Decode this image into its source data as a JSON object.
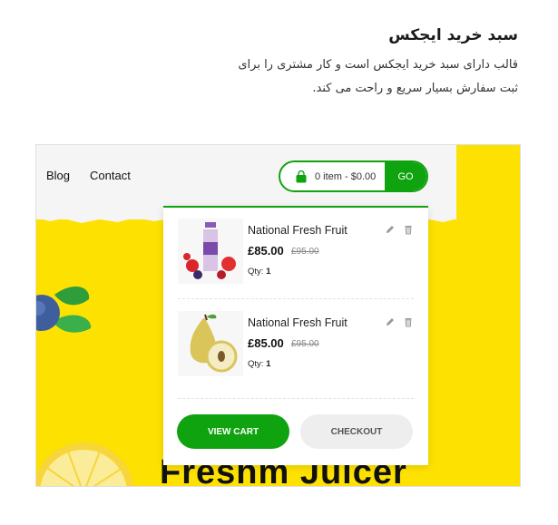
{
  "intro": {
    "title": "سبد خرید ایجکس",
    "line1": "قالب دارای سبد خرید ایجکس است و کار مشتری را برای",
    "line2": "ثبت سفارش بسیار سریع و راحت می کند."
  },
  "nav": {
    "items": [
      "Blog",
      "Contact"
    ]
  },
  "cart": {
    "summary": "0 item - $0.00",
    "go_label": "GO"
  },
  "hero": {
    "text": "Freshm Juicer"
  },
  "dropdown": {
    "items": [
      {
        "name": "National Fresh Fruit",
        "price": "£85.00",
        "old_price": "£95.00",
        "qty_label": "Qty:",
        "qty": "1",
        "image": "juice-bottle-image"
      },
      {
        "name": "National Fresh Fruit",
        "price": "£85.00",
        "old_price": "£95.00",
        "qty_label": "Qty:",
        "qty": "1",
        "image": "pear-image"
      }
    ],
    "view_cart_label": "VIEW CART",
    "checkout_label": "CHECKOUT"
  },
  "colors": {
    "accent": "#10a310",
    "background": "#fde100",
    "frame_border": "#dedede"
  }
}
